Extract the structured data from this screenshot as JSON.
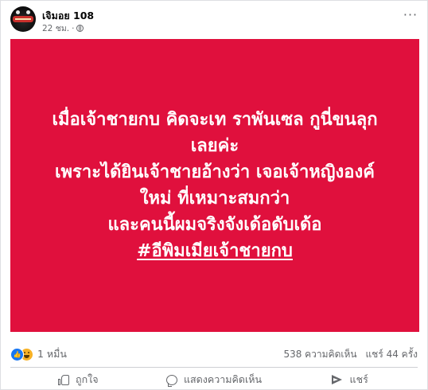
{
  "post": {
    "author": "เจิมอย 108",
    "time": "22 ชม.",
    "more_label": "···",
    "icons": {
      "avatar": "channel-logo",
      "privacy": "globe-icon",
      "more": "more-options-icon"
    },
    "background_color": "#e0103d",
    "text_lines": [
      "เมื่อเจ้าชายกบ คิดจะเท ราพันเซล กูนี่ขนลุก",
      "เลยค่ะ",
      "เพราะได้ยินเจ้าชายอ้างว่า เจอเจ้าหญิงองค์",
      "ใหม่ ที่เหมาะสมกว่า",
      "และคนนี้ผมจริงจังเด้อดับเด้อ"
    ],
    "hashtag": "#อีพิมเมียเจ้าชายกบ"
  },
  "stats": {
    "reaction_count": "1 หมื่น",
    "reaction_icons": [
      "like-icon",
      "haha-icon"
    ],
    "comments": "538 ความคิดเห็น",
    "shares": "แชร์ 44 ครั้ง"
  },
  "actions": {
    "like": "ถูกใจ",
    "comment": "แสดงความคิดเห็น",
    "share": "แชร์"
  }
}
